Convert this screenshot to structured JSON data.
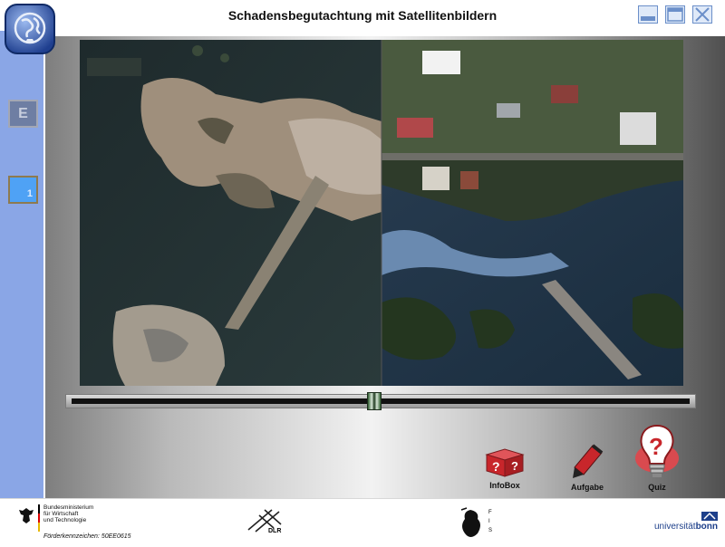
{
  "window": {
    "title": "Schadensbegutachtung mit Satellitenbildern",
    "buttons": [
      "minimize",
      "maximize",
      "close"
    ]
  },
  "sidebar": {
    "language_button": "E",
    "page_button": "1"
  },
  "slider": {
    "position": 0.49
  },
  "actions": {
    "infobox_label": "InfoBox",
    "aufgabe_label": "Aufgabe",
    "quiz_label": "Quiz"
  },
  "footer": {
    "ministry_lines": [
      "Bundesministerium",
      "für Wirtschaft",
      "und Technologie"
    ],
    "funding_ref": "Förderkennzeichen: 50EE0615",
    "dlr_label": "DLR",
    "fis_label": "FIS",
    "university_prefix": "universität",
    "university_name": "bonn"
  },
  "colors": {
    "sidebar": "#8aa6e6",
    "accent_blue": "#4fa2f5",
    "action_red": "#c8262b"
  }
}
